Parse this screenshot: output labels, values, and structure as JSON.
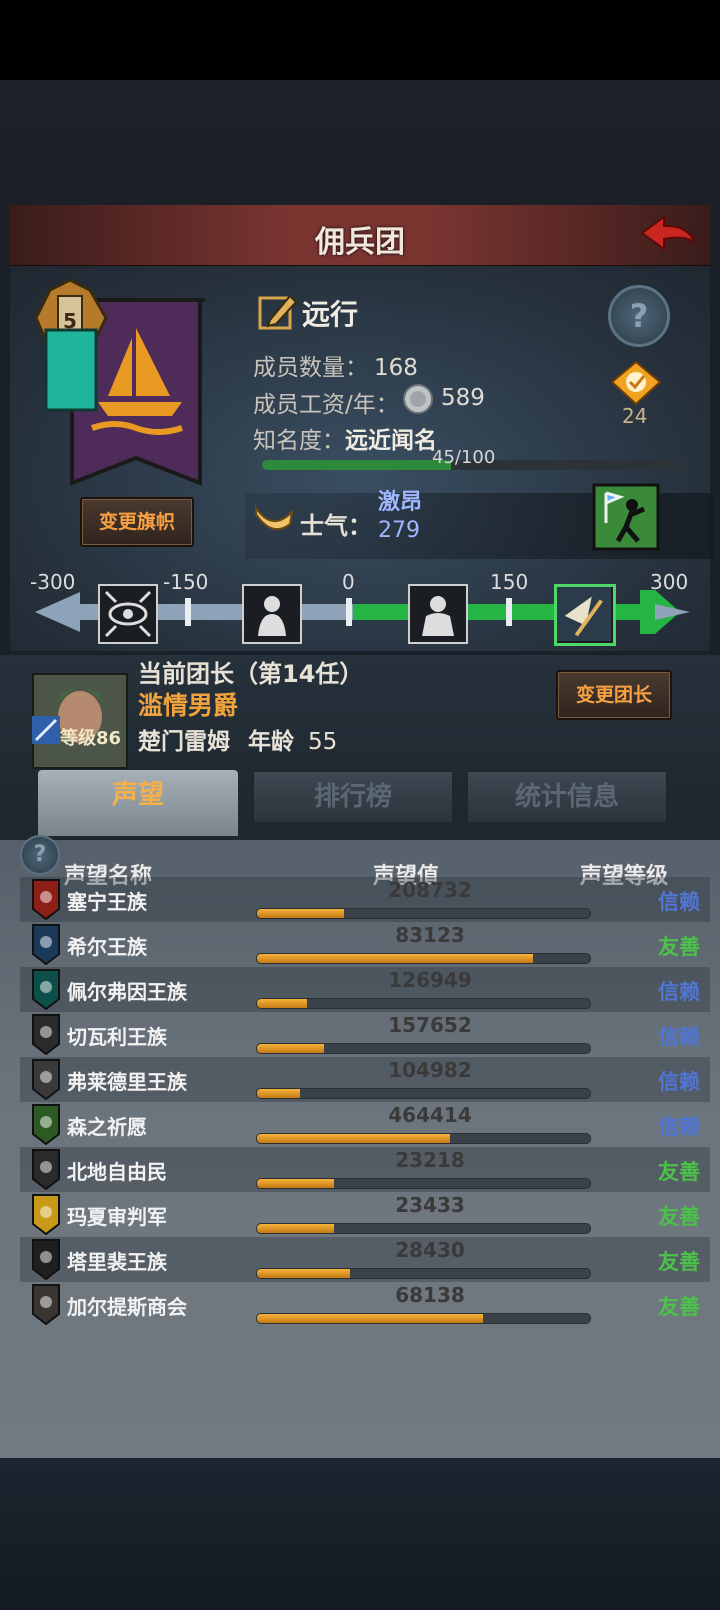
{
  "page_title": "佣兵团",
  "company": {
    "name": "远行",
    "members_label": "成员数量：",
    "members": "168",
    "wage_label": "成员工资/年：",
    "wage": "589",
    "renown_label": "知名度：",
    "renown_name": "远近闻名",
    "renown_progress": "45/100",
    "renown_fraction": 0.45,
    "badge_count": "24",
    "emblem_number": "5",
    "change_banner_label": "变更旗帜",
    "morale_label": "士气：",
    "morale_state": "激昂",
    "morale_value": "279"
  },
  "morale_scale": {
    "ticks": [
      "-300",
      "-150",
      "0",
      "150",
      "300"
    ],
    "active_index": 3
  },
  "leader": {
    "heading": "当前团长（第14任）",
    "title": "滥情男爵",
    "name": "楚门雷姆",
    "age_label": "年龄",
    "age": "55",
    "level_label": "等级86",
    "change_leader_label": "变更团长"
  },
  "tabs": [
    {
      "label": "声望",
      "active": true
    },
    {
      "label": "排行榜",
      "active": false
    },
    {
      "label": "统计信息",
      "active": false
    }
  ],
  "table": {
    "col_name": "声望名称",
    "col_value": "声望值",
    "col_level": "声望等级",
    "rows": [
      {
        "name": "塞宁王族",
        "value": "208732",
        "level": "信赖",
        "fill": 0.26,
        "shield_color": "#8e1f16",
        "level_color": "#4f76d6"
      },
      {
        "name": "希尔王族",
        "value": "83123",
        "level": "友善",
        "fill": 0.83,
        "shield_color": "#1b3a5a",
        "level_color": "#4cc24a"
      },
      {
        "name": "佩尔弗因王族",
        "value": "126949",
        "level": "信赖",
        "fill": 0.15,
        "shield_color": "#0d4f4a",
        "level_color": "#4f76d6"
      },
      {
        "name": "切瓦利王族",
        "value": "157652",
        "level": "信赖",
        "fill": 0.2,
        "shield_color": "#2b2b2b",
        "level_color": "#4f76d6"
      },
      {
        "name": "弗莱德里王族",
        "value": "104982",
        "level": "信赖",
        "fill": 0.13,
        "shield_color": "#3a3a3a",
        "level_color": "#4f76d6"
      },
      {
        "name": "森之祈愿",
        "value": "464414",
        "level": "信赖",
        "fill": 0.58,
        "shield_color": "#2b5a22",
        "level_color": "#4f76d6"
      },
      {
        "name": "北地自由民",
        "value": "23218",
        "level": "友善",
        "fill": 0.23,
        "shield_color": "#2a2a2a",
        "level_color": "#4cc24a"
      },
      {
        "name": "玛夏审判军",
        "value": "23433",
        "level": "友善",
        "fill": 0.23,
        "shield_color": "#c79a17",
        "level_color": "#4cc24a"
      },
      {
        "name": "塔里裴王族",
        "value": "28430",
        "level": "友善",
        "fill": 0.28,
        "shield_color": "#1f1f1f",
        "level_color": "#4cc24a"
      },
      {
        "name": "加尔提斯商会",
        "value": "68138",
        "level": "友善",
        "fill": 0.68,
        "shield_color": "#3a3530",
        "level_color": "#4cc24a"
      }
    ]
  }
}
